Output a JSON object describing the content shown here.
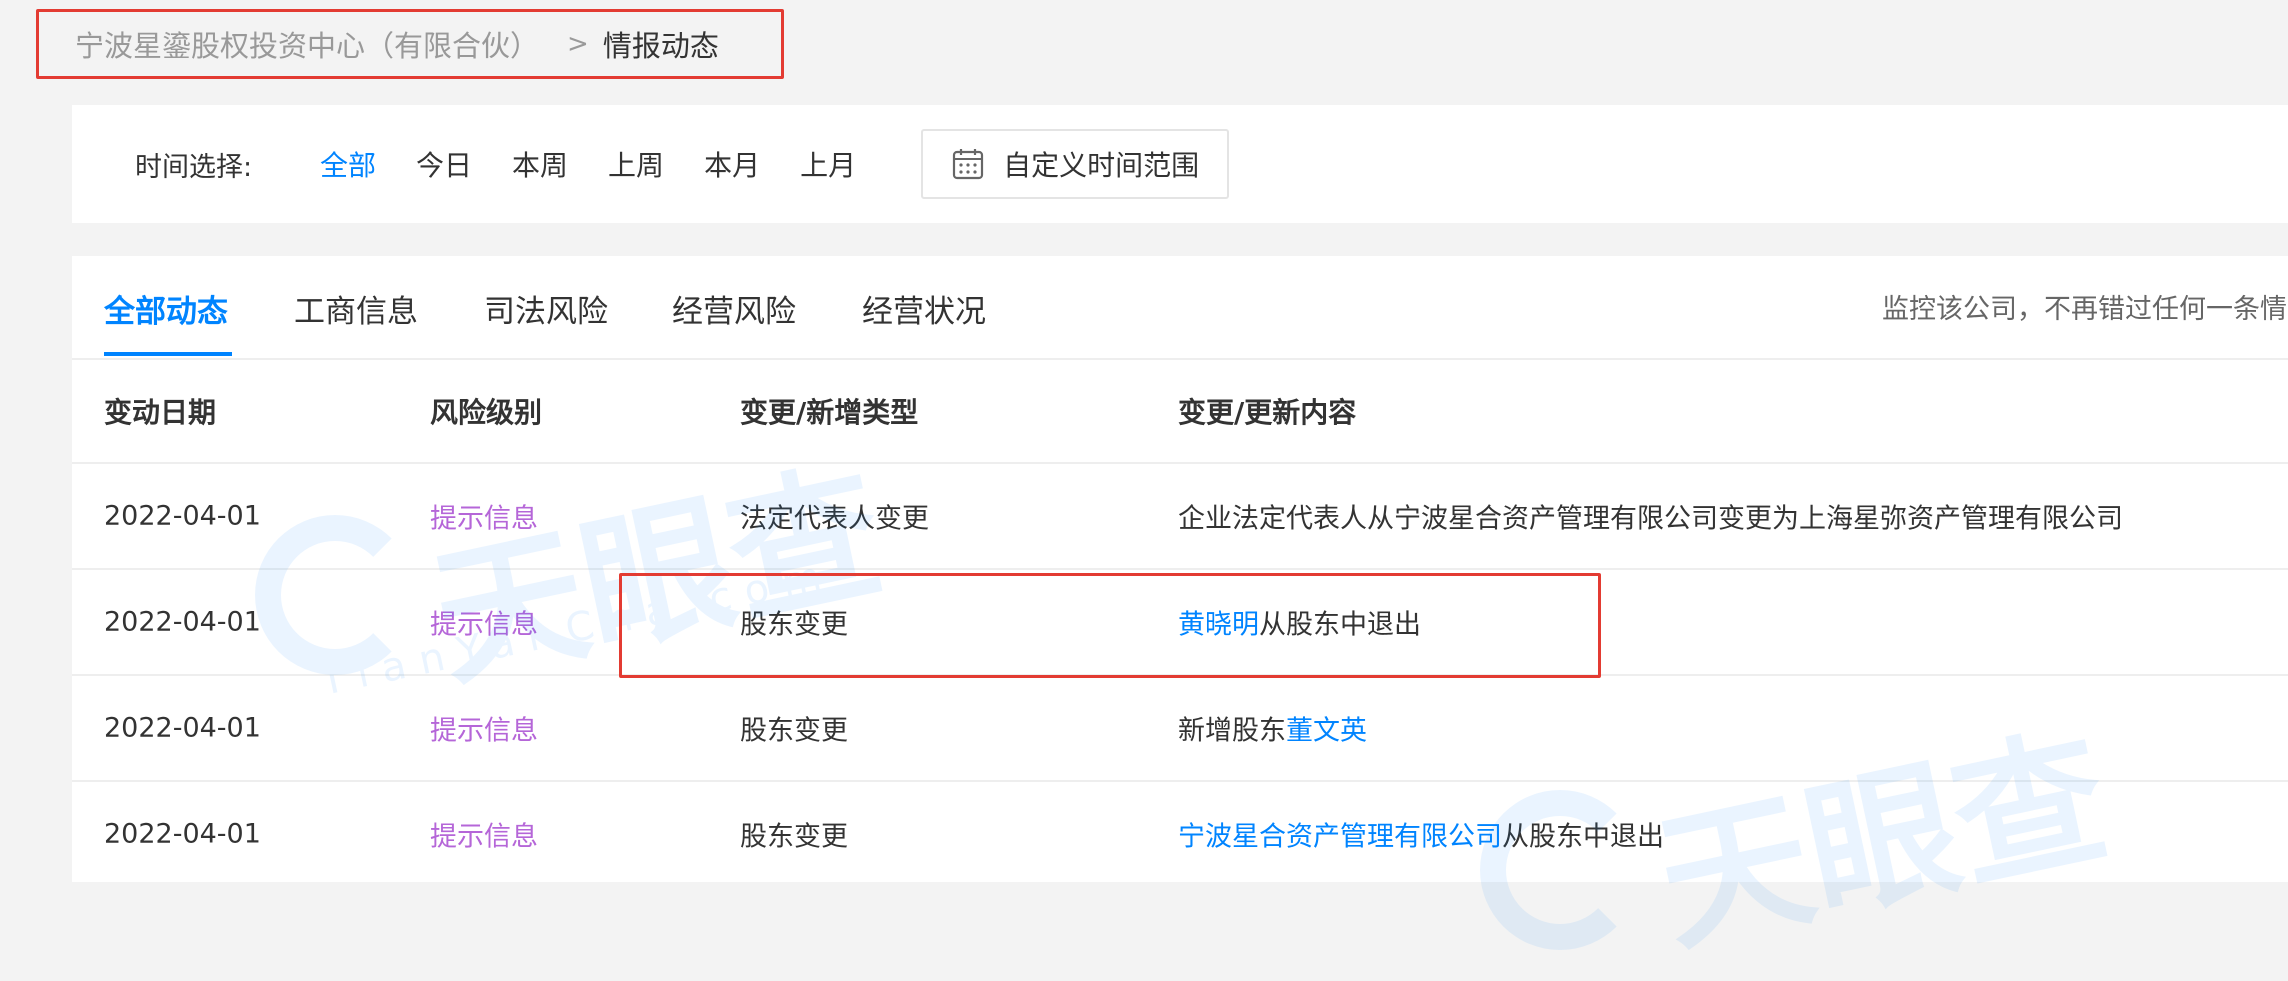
{
  "breadcrumb": {
    "company": "宁波星鎏股权投资中心（有限合伙）",
    "separator": ">",
    "current": "情报动态"
  },
  "filter": {
    "label": "时间选择:",
    "options": [
      "全部",
      "今日",
      "本周",
      "上周",
      "本月",
      "上月"
    ],
    "active_option": "全部",
    "custom_range_label": "自定义时间范围"
  },
  "tabs": {
    "items": [
      "全部动态",
      "工商信息",
      "司法风险",
      "经营风险",
      "经营状况"
    ],
    "active": "全部动态",
    "monitor_text": "监控该公司，不再错过任何一条情"
  },
  "table": {
    "headers": [
      "变动日期",
      "风险级别",
      "变更/新增类型",
      "变更/更新内容"
    ],
    "rows": [
      {
        "date": "2022-04-01",
        "risk": "提示信息",
        "type": "法定代表人变更",
        "content_prefix": "企业法定代表人从宁波星合资产管理有限公司变更为上海星弥资产管理有限公司",
        "content_link": "",
        "content_suffix": ""
      },
      {
        "date": "2022-04-01",
        "risk": "提示信息",
        "type": "股东变更",
        "content_prefix": "",
        "content_link": "黄晓明",
        "content_suffix": "从股东中退出"
      },
      {
        "date": "2022-04-01",
        "risk": "提示信息",
        "type": "股东变更",
        "content_prefix": "新增股东",
        "content_link": "董文英",
        "content_suffix": ""
      },
      {
        "date": "2022-04-01",
        "risk": "提示信息",
        "type": "股东变更",
        "content_prefix": "",
        "content_link": "宁波星合资产管理有限公司",
        "content_suffix": "从股东中退出"
      }
    ]
  },
  "watermark": {
    "text": "天眼查",
    "subtext": "TianYanCha.com"
  },
  "colors": {
    "accent": "#0084ff",
    "risk_hint": "#b566d8",
    "highlight": "#e33b32"
  }
}
